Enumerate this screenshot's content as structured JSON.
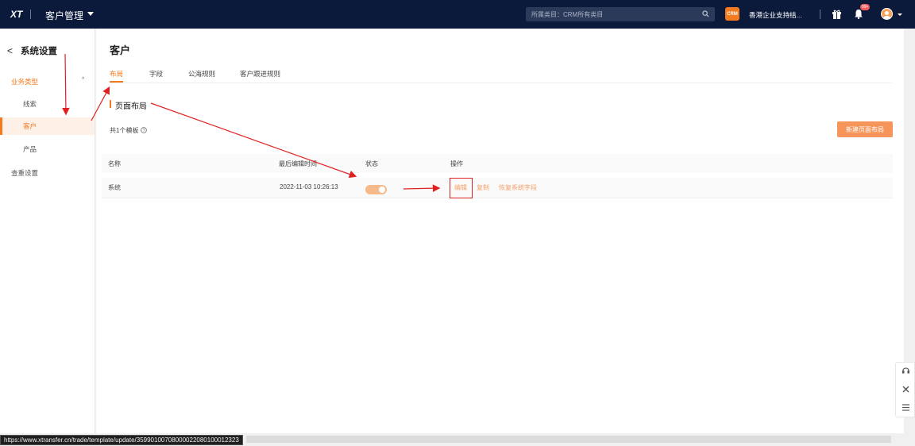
{
  "topbar": {
    "logo": "XT",
    "app_title": "客户管理",
    "search_placeholder": "所属类目：CRM所有类目",
    "crm_badge": "CRM",
    "company": "香港企业支持结...",
    "notification_badge": "99+"
  },
  "sidebar": {
    "title": "系统设置",
    "group_label": "业务类型",
    "items": [
      {
        "label": "线索"
      },
      {
        "label": "客户"
      },
      {
        "label": "产品"
      }
    ],
    "bottom_item": "查重设置"
  },
  "main": {
    "page_title": "客户",
    "tabs": [
      {
        "label": "布局"
      },
      {
        "label": "字段"
      },
      {
        "label": "公海规则"
      },
      {
        "label": "客户跟进规则"
      }
    ],
    "section_title": "页面布局",
    "count_text": "共1个模板",
    "new_button": "新建页面布局",
    "table": {
      "headers": [
        "名称",
        "最后编辑时间",
        "状态",
        "操作"
      ],
      "rows": [
        {
          "name": "系统",
          "time": "2022-11-03 10:26:13",
          "status_on": true,
          "actions": [
            "编辑",
            "复制",
            "恢复系统字段"
          ]
        }
      ]
    }
  },
  "status_bar": {
    "url": "https://www.xtransfer.cn/trade/template/update/359901007080000220801000​12323"
  },
  "colors": {
    "accent": "#f47a1f",
    "topbar": "#0b1a3a",
    "annotation": "#e02020"
  }
}
